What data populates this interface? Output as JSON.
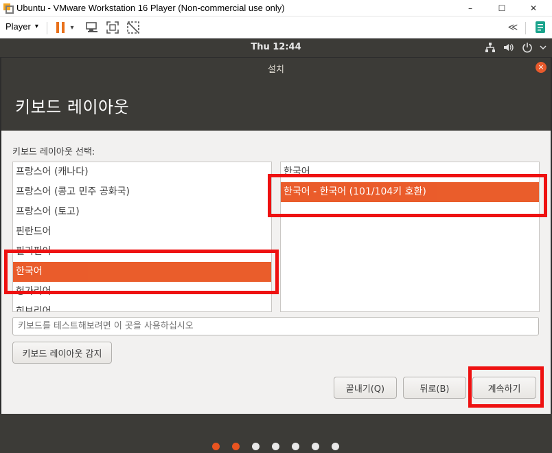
{
  "vmware": {
    "title": "Ubuntu - VMware Workstation 16 Player (Non-commercial use only)",
    "minimize": "–",
    "maximize": "☐",
    "close": "✕",
    "player_menu": "Player",
    "player_caret": "▾",
    "pause_caret": "▾",
    "collapse": "≪"
  },
  "ubuntu": {
    "clock": "Thu 12:44"
  },
  "installer": {
    "window_title": "설치",
    "close_glyph": "×",
    "heading": "키보드 레이아웃",
    "section_label": "키보드 레이아웃 선택:",
    "layouts": [
      "프랑스어 (캐나다)",
      "프랑스어 (콩고 민주 공화국)",
      "프랑스어 (토고)",
      "핀란드어",
      "필리핀어",
      "한국어",
      "헝가리어",
      "히브리어"
    ],
    "selected_layout_index": 5,
    "variants": [
      "한국어",
      "한국어 - 한국어 (101/104키 호환)"
    ],
    "selected_variant_index": 1,
    "test_placeholder": "키보드를 테스트해보려면 이 곳을 사용하십시오",
    "detect_button": "키보드 레이아웃 감지",
    "quit_button": "끝내기(Q)",
    "back_button": "뒤로(B)",
    "continue_button": "계속하기"
  },
  "progress": {
    "total_steps": 7,
    "current_step": 2,
    "done_color": "#e95420",
    "todo_color": "#e8e8e8"
  },
  "colors": {
    "accent": "#e95420",
    "annotation": "#ee1111",
    "header_bg": "#3c3b37"
  }
}
